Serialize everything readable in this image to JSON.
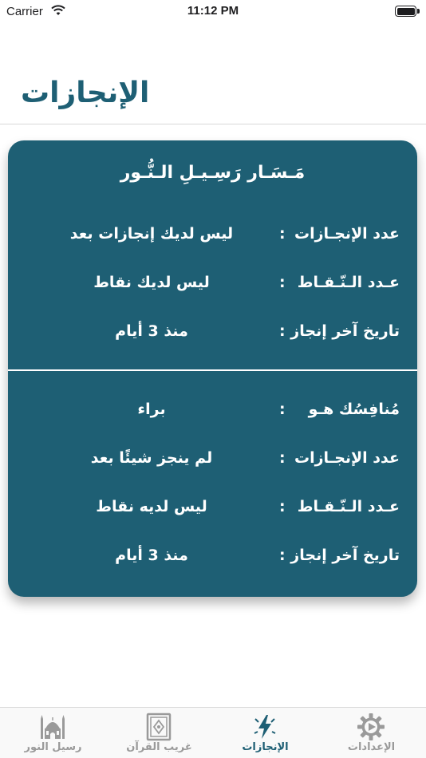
{
  "status": {
    "carrier": "Carrier",
    "time": "11:12 PM"
  },
  "page": {
    "title": "الإنجازات"
  },
  "card": {
    "title": "مَـسَـار رَسِـيـلِ الـنُّـور",
    "user_rows": [
      {
        "label": "عدد الإنجـازات",
        "value": "ليس لديك إنجازات بعد"
      },
      {
        "label": "عـدد الـنّـقـاط",
        "value": "ليس لديك نقاط"
      },
      {
        "label": "تاريخ آخر إنجاز",
        "value": "منذ 3 أيام"
      }
    ],
    "competitor_rows": [
      {
        "label": "مُنافِسُك هـو",
        "value": "براء"
      },
      {
        "label": "عدد الإنجـازات",
        "value": "لم ينجز شيئًا بعد"
      },
      {
        "label": "عـدد الـنّـقـاط",
        "value": "ليس لديه نقاط"
      },
      {
        "label": "تاريخ آخر إنجاز",
        "value": "منذ 3 أيام"
      }
    ],
    "colon": ":"
  },
  "tabs": [
    {
      "label": "رسيل النور",
      "icon": "mosque-icon",
      "active": false
    },
    {
      "label": "غريب القرآن",
      "icon": "quran-book-icon",
      "active": false
    },
    {
      "label": "الإنجازات",
      "icon": "lightning-icon",
      "active": true
    },
    {
      "label": "الإعدادات",
      "icon": "gear-icon",
      "active": false
    }
  ],
  "colors": {
    "primary": "#1e5f74",
    "inactive": "#9a9a9a"
  }
}
